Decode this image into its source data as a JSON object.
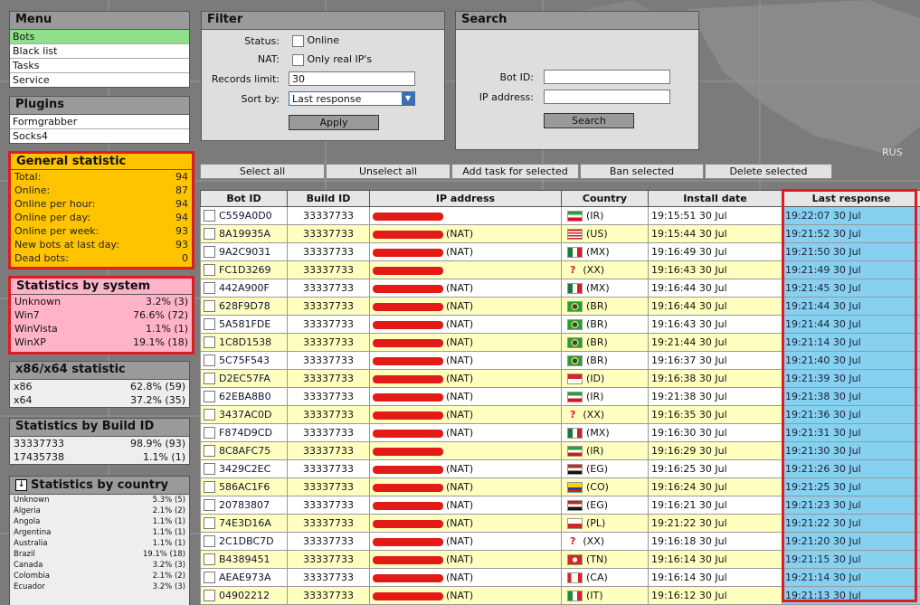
{
  "menu": {
    "title": "Menu",
    "items": [
      {
        "label": "Bots",
        "active": true
      },
      {
        "label": "Black list",
        "active": false
      },
      {
        "label": "Tasks",
        "active": false
      },
      {
        "label": "Service",
        "active": false
      }
    ]
  },
  "plugins": {
    "title": "Plugins",
    "items": [
      "Formgrabber",
      "Socks4"
    ]
  },
  "general": {
    "title": "General statistic",
    "rows": [
      {
        "label": "Total:",
        "value": "94"
      },
      {
        "label": "Online:",
        "value": "87"
      },
      {
        "label": "Online per hour:",
        "value": "94"
      },
      {
        "label": "Online per day:",
        "value": "94"
      },
      {
        "label": "Online per week:",
        "value": "93"
      },
      {
        "label": "New bots at last day:",
        "value": "93"
      },
      {
        "label": "Dead bots:",
        "value": "0"
      }
    ]
  },
  "system": {
    "title": "Statistics by system",
    "rows": [
      {
        "label": "Unknown",
        "value": "3.2% (3)"
      },
      {
        "label": "Win7",
        "value": "76.6% (72)"
      },
      {
        "label": "WinVista",
        "value": "1.1% (1)"
      },
      {
        "label": "WinXP",
        "value": "19.1% (18)"
      }
    ]
  },
  "arch": {
    "title": "x86/x64 statistic",
    "rows": [
      {
        "label": "x86",
        "value": "62.8% (59)"
      },
      {
        "label": "x64",
        "value": "37.2% (35)"
      }
    ]
  },
  "build": {
    "title": "Statistics by Build ID",
    "rows": [
      {
        "label": "33337733",
        "value": "98.9% (93)"
      },
      {
        "label": "17435738",
        "value": "1.1% (1)"
      }
    ]
  },
  "country_stats": {
    "title": "Statistics by country",
    "rows": [
      {
        "label": "Unknown",
        "value": "5.3% (5)"
      },
      {
        "label": "Algeria",
        "value": "2.1% (2)"
      },
      {
        "label": "Angola",
        "value": "1.1% (1)"
      },
      {
        "label": "Argentina",
        "value": "1.1% (1)"
      },
      {
        "label": "Australia",
        "value": "1.1% (1)"
      },
      {
        "label": "Brazil",
        "value": "19.1% (18)"
      },
      {
        "label": "Canada",
        "value": "3.2% (3)"
      },
      {
        "label": "Colombia",
        "value": "2.1% (2)"
      },
      {
        "label": "Ecuador",
        "value": "3.2% (3)"
      }
    ]
  },
  "filter": {
    "title": "Filter",
    "status_label": "Status:",
    "online_label": "Online",
    "nat_label": "NAT:",
    "real_ip_label": "Only real IP's",
    "records_label": "Records limit:",
    "records_value": "30",
    "sort_label": "Sort by:",
    "sort_value": "Last response",
    "apply_label": "Apply"
  },
  "search": {
    "title": "Search",
    "botid_label": "Bot ID:",
    "ip_label": "IP address:",
    "button_label": "Search"
  },
  "actions": {
    "select_all": "Select all",
    "unselect_all": "Unselect all",
    "add_task": "Add task for selected",
    "ban": "Ban selected",
    "delete": "Delete selected"
  },
  "table": {
    "columns": [
      "Bot ID",
      "Build ID",
      "IP address",
      "Country",
      "Install date",
      "Last response"
    ],
    "rows": [
      {
        "bot": "C559A0D0",
        "build": "33337733",
        "nat": "",
        "cc": "(IR)",
        "flag": "ir",
        "install": "19:15:51 30 Jul",
        "last": "19:22:07 30 Jul"
      },
      {
        "bot": "8A19935A",
        "build": "33337733",
        "nat": "(NAT)",
        "cc": "(US)",
        "flag": "us",
        "install": "19:15:44 30 Jul",
        "last": "19:21:52 30 Jul"
      },
      {
        "bot": "9A2C9031",
        "build": "33337733",
        "nat": "(NAT)",
        "cc": "(MX)",
        "flag": "mx",
        "install": "19:16:49 30 Jul",
        "last": "19:21:50 30 Jul"
      },
      {
        "bot": "FC1D3269",
        "build": "33337733",
        "nat": "",
        "cc": "(XX)",
        "flag": "xx",
        "install": "19:16:43 30 Jul",
        "last": "19:21:49 30 Jul"
      },
      {
        "bot": "442A900F",
        "build": "33337733",
        "nat": "(NAT)",
        "cc": "(MX)",
        "flag": "mx",
        "install": "19:16:44 30 Jul",
        "last": "19:21:45 30 Jul"
      },
      {
        "bot": "628F9D78",
        "build": "33337733",
        "nat": "(NAT)",
        "cc": "(BR)",
        "flag": "br",
        "install": "19:16:44 30 Jul",
        "last": "19:21:44 30 Jul"
      },
      {
        "bot": "5A581FDE",
        "build": "33337733",
        "nat": "(NAT)",
        "cc": "(BR)",
        "flag": "br",
        "install": "19:16:43 30 Jul",
        "last": "19:21:44 30 Jul"
      },
      {
        "bot": "1C8D1538",
        "build": "33337733",
        "nat": "(NAT)",
        "cc": "(BR)",
        "flag": "br",
        "install": "19:21:44 30 Jul",
        "last": "19:21:14 30 Jul"
      },
      {
        "bot": "5C75F543",
        "build": "33337733",
        "nat": "(NAT)",
        "cc": "(BR)",
        "flag": "br",
        "install": "19:16:37 30 Jul",
        "last": "19:21:40 30 Jul"
      },
      {
        "bot": "D2EC57FA",
        "build": "33337733",
        "nat": "(NAT)",
        "cc": "(ID)",
        "flag": "id",
        "install": "19:16:38 30 Jul",
        "last": "19:21:39 30 Jul"
      },
      {
        "bot": "62EBA8B0",
        "build": "33337733",
        "nat": "(NAT)",
        "cc": "(IR)",
        "flag": "ir",
        "install": "19:21:38 30 Jul",
        "last": "19:21:38 30 Jul"
      },
      {
        "bot": "3437AC0D",
        "build": "33337733",
        "nat": "(NAT)",
        "cc": "(XX)",
        "flag": "xx",
        "install": "19:16:35 30 Jul",
        "last": "19:21:36 30 Jul"
      },
      {
        "bot": "F874D9CD",
        "build": "33337733",
        "nat": "(NAT)",
        "cc": "(MX)",
        "flag": "mx",
        "install": "19:16:30 30 Jul",
        "last": "19:21:31 30 Jul"
      },
      {
        "bot": "8C8AFC75",
        "build": "33337733",
        "nat": "",
        "cc": "(IR)",
        "flag": "ir",
        "install": "19:16:29 30 Jul",
        "last": "19:21:30 30 Jul"
      },
      {
        "bot": "3429C2EC",
        "build": "33337733",
        "nat": "(NAT)",
        "cc": "(EG)",
        "flag": "eg",
        "install": "19:16:25 30 Jul",
        "last": "19:21:26 30 Jul"
      },
      {
        "bot": "586AC1F6",
        "build": "33337733",
        "nat": "(NAT)",
        "cc": "(CO)",
        "flag": "co",
        "install": "19:16:24 30 Jul",
        "last": "19:21:25 30 Jul"
      },
      {
        "bot": "20783807",
        "build": "33337733",
        "nat": "(NAT)",
        "cc": "(EG)",
        "flag": "eg",
        "install": "19:16:21 30 Jul",
        "last": "19:21:23 30 Jul"
      },
      {
        "bot": "74E3D16A",
        "build": "33337733",
        "nat": "(NAT)",
        "cc": "(PL)",
        "flag": "pl",
        "install": "19:21:22 30 Jul",
        "last": "19:21:22 30 Jul"
      },
      {
        "bot": "2C1DBC7D",
        "build": "33337733",
        "nat": "(NAT)",
        "cc": "(XX)",
        "flag": "xx",
        "install": "19:16:18 30 Jul",
        "last": "19:21:20 30 Jul"
      },
      {
        "bot": "B4389451",
        "build": "33337733",
        "nat": "(NAT)",
        "cc": "(TN)",
        "flag": "tn",
        "install": "19:16:14 30 Jul",
        "last": "19:21:15 30 Jul"
      },
      {
        "bot": "AEAE973A",
        "build": "33337733",
        "nat": "(NAT)",
        "cc": "(CA)",
        "flag": "ca",
        "install": "19:16:14 30 Jul",
        "last": "19:21:14 30 Jul"
      },
      {
        "bot": "04902212",
        "build": "33337733",
        "nat": "(NAT)",
        "cc": "(IT)",
        "flag": "it",
        "install": "19:16:12 30 Jul",
        "last": "19:21:13 30 Jul"
      }
    ]
  },
  "colors": {
    "general_bg": "#ffc400",
    "system_bg": "#ffb3c9",
    "highlight_frame": "#e21b23",
    "last_response_bg": "#86d0f0",
    "row_alt": "#ffffc0",
    "active_menu": "#8fe08a"
  },
  "map_labels": {
    "rus": "RUS"
  }
}
